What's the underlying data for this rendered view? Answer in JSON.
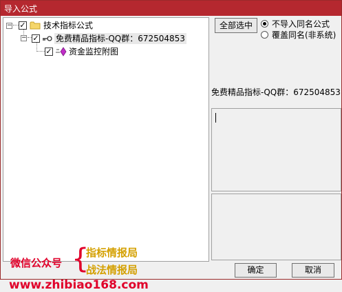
{
  "window": {
    "title": "导入公式"
  },
  "tree": {
    "root": {
      "label": "技术指标公式",
      "checked": "✓",
      "expander": "−"
    },
    "child": {
      "label": "免费精品指标-QQ群：672504853",
      "checked": "✓",
      "expander": "−"
    },
    "leaf": {
      "label": "资金监控附图",
      "checked": "✓"
    }
  },
  "controls": {
    "select_all": "全部选中",
    "radio_no_import": "不导入同名公式",
    "radio_overwrite": "覆盖同名(非系统)",
    "selected_formula": "免费精品指标-QQ群：672504853"
  },
  "watermark": {
    "account_label": "微信公众号",
    "brace": "{",
    "line1": "指标情报局",
    "line2": "战法情报局",
    "url": "www.zhibiao168.com"
  },
  "footer": {
    "ok": "确定",
    "cancel": "取消"
  },
  "colors": {
    "titlebar": "#b5282f",
    "watermark_red": "#e0002a",
    "watermark_gold": "#d4a000"
  }
}
